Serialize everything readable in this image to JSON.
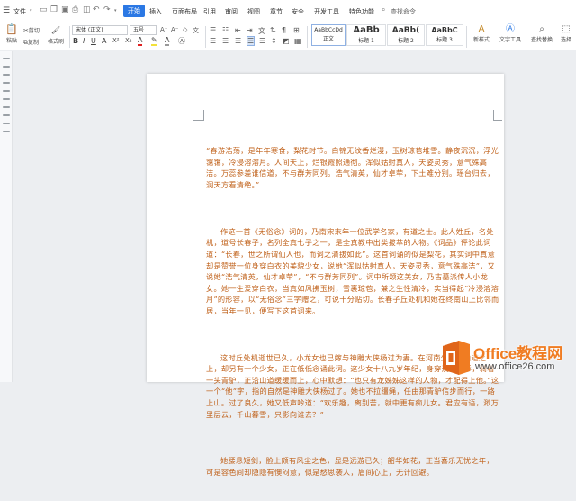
{
  "menubar": {
    "file_label": "文件",
    "tabs": [
      "开始",
      "插入",
      "页面布局",
      "引用",
      "审阅",
      "视图",
      "章节",
      "安全",
      "开发工具",
      "特色功能"
    ],
    "active_tab": "开始",
    "search_label": "查找命令"
  },
  "ribbon": {
    "paste_label": "粘贴",
    "cut_label": "剪切",
    "copy_label": "复制",
    "format_painter_label": "格式刷",
    "font_name": "宋体 (正文)",
    "font_size": "五号",
    "styles": [
      {
        "sample": "AaBbCcDd",
        "name": "正文"
      },
      {
        "sample": "AaBb",
        "name": "标题 1"
      },
      {
        "sample": "AaBb(",
        "name": "标题 2"
      },
      {
        "sample": "AaBbC",
        "name": "标题 3"
      }
    ],
    "new_style_label": "新样式",
    "text_tool_label": "文字工具",
    "find_replace_label": "查找替换",
    "select_label": "选择"
  },
  "document": {
    "paragraphs": [
      "“春游浩荡，是年年寒食，梨花时节。白锦无纹香烂漫，玉树琼苞堆雪。静夜沉沉，浮光霭霭，冷浸溶溶月。人间天上，烂银霞照通彻。浑似姑射真人，天姿灵秀，意气殊高洁。万蕊参差谁信道，不与群芳同列。浩气清英，仙才卓荦，下土难分别。瑶台归去，洞天方看清绝。”",
      "作这一首《无俗念》词的，乃南宋末年一位武学名家，有道之士。此人姓丘，名处机，道号长春子，名列全真七子之一，是全真教中出类拔萃的人物。《词品》评论此词道：“长春，世之所谓仙人也，而词之清拔如此”。这首词诵的似是梨花，其实词中真意却是赞誉一位身穿白衣的美貌少女，说她“浑似姑射真人，天姿灵秀，意气殊高洁”，又说她“浩气清英，仙才卓荦”，“不与群芳同列”。词中所颂这美女，乃古墓派传人小龙女。她一生爱穿白衣，当真如风拂玉树，雪裹琼苞，兼之生性清冷，实当得起“冷浸溶溶月”的形容，以“无俗念”三字赠之，可说十分贴切。长春子丘处机和她在终南山上比邻而居，当年一见，便写下这首词来。",
      "这时丘处机逝世已久，小龙女也已嫁与神雕大侠杨过为妻。在河南少室山山道之上，却另有一个少女，正在低低念诵此词。这少女十八九岁年纪，身穿淡黄衣衫，骑着一头青驴，正沿山道缓缓而上，心中默想：“也只有龙姊姊这样的人物，才配得上他。”这一个“他”字，指的自然是神雕大侠杨过了。她也不拉缰绳，任由那青驴信步而行，一路上山。过了良久，她又低声吟道：“欢乐趣，离别苦，就中更有痴儿女。君应有语，渺万里层云，千山暮雪，只影向谁去？”",
      "她腰悬短剑，脸上颇有风尘之色，显是远游已久；韶华如花，正当喜乐无忧之年，可是容色间却隐隐有懊闷意，似是愁思袭人，眉间心上，无计回避。"
    ]
  },
  "watermark": {
    "brand": "Office教程网",
    "url": "www.office26.com"
  },
  "colors": {
    "doc_text": "#c0611a",
    "accent": "#2b78e4",
    "watermark_orange": "#f07c22"
  }
}
